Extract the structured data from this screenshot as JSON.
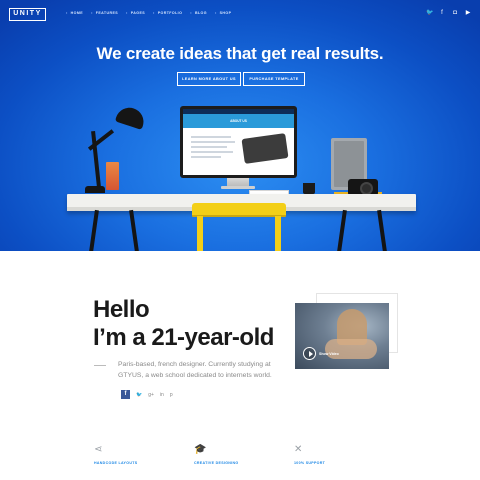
{
  "nav": {
    "logo": "UNITY",
    "menu": [
      "HOME",
      "FEATURES",
      "PAGES",
      "PORTFOLIO",
      "BLOG",
      "SHOP"
    ],
    "social_icons": [
      "twitter-icon",
      "facebook-icon",
      "instagram-icon",
      "youtube-icon"
    ],
    "social_glyphs": [
      "🐦",
      "f",
      "◘",
      "▶"
    ]
  },
  "hero": {
    "headline": "We create ideas that get real results.",
    "cta_primary": "LEARN MORE ABOUT US",
    "cta_secondary": "PURCHASE TEMPLATE",
    "screen_title": "ABOUT US"
  },
  "about": {
    "hello_line1": "Hello",
    "hello_line2": "I’m a 21-year-old",
    "description": "Paris-based, french designer. Currently studying at GTYUS, a web school dedicated to internets world.",
    "share_glyphs": [
      "f",
      "🐦",
      "g+",
      "in",
      "p"
    ]
  },
  "video": {
    "label": "Show Video"
  },
  "features": [
    {
      "icon": "share-icon",
      "glyph": "⋖",
      "label": "HANDCODE LAYOUTS"
    },
    {
      "icon": "graduation-cap-icon",
      "glyph": "🎓",
      "label": "CREATIVE DESIGNING"
    },
    {
      "icon": "tools-icon",
      "glyph": "✕",
      "label": "100% SUPPORT"
    }
  ],
  "colors": {
    "hero_blue": "#1a6fe0",
    "accent": "#1e88e5",
    "chair_yellow": "#f3cf17",
    "facebook": "#3b5998"
  }
}
